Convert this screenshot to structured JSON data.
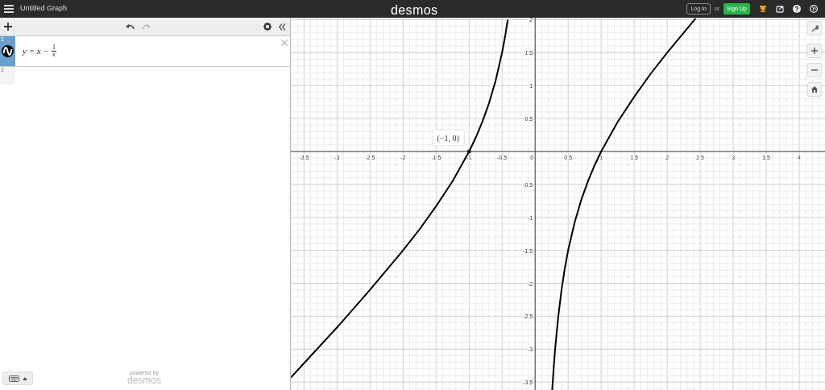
{
  "header": {
    "title": "Untitled Graph",
    "logo": "desmos",
    "login": "Log In",
    "or": "or",
    "signup": "Sign Up"
  },
  "toolbar": {
    "redo_disabled": true
  },
  "expressions": [
    {
      "number": "1",
      "selected": true,
      "expression": {
        "before": "y = x −",
        "numerator": "1",
        "denominator": "x"
      }
    },
    {
      "number": "2",
      "selected": false
    }
  ],
  "footer": {
    "powered": "powered by",
    "brand": "desmos"
  },
  "graph": {
    "chart_data": {
      "type": "line",
      "grid": true,
      "xlim": [
        -3.7,
        4.39
      ],
      "ylim": [
        -3.62,
        2.03
      ],
      "xticks": [
        -3.5,
        -3,
        -2.5,
        -2,
        -1.5,
        -1,
        -0.5,
        0,
        0.5,
        1,
        1.5,
        2,
        2.5,
        3,
        3.5,
        4
      ],
      "yticks": [
        -3.5,
        -3,
        -2.5,
        -2,
        -1.5,
        -1,
        -0.5,
        0.5,
        1,
        1.5,
        2
      ],
      "x": [
        -3.7,
        -3,
        -2.5,
        -2,
        -1.75,
        -1.5,
        -1.25,
        -1,
        -0.9,
        -0.8,
        -0.7,
        -0.6,
        -0.5,
        -0.45,
        -0.415,
        0.258,
        0.28,
        0.3,
        0.32,
        0.35,
        0.4,
        0.45,
        0.5,
        0.6,
        0.7,
        0.8,
        0.9,
        1,
        1.25,
        1.5,
        1.75,
        2,
        2.43
      ],
      "series": [
        {
          "color": "#000000",
          "values": [
            -3.43,
            -2.67,
            -2.1,
            -1.5,
            -1.18,
            -0.83,
            -0.45,
            0,
            0.21,
            0.45,
            0.73,
            1.07,
            1.5,
            1.77,
            2,
            -3.62,
            -3.29,
            -3.03,
            -2.81,
            -2.51,
            -2.1,
            -1.77,
            -1.5,
            -1.07,
            -0.73,
            -0.45,
            -0.21,
            0,
            0.45,
            0.83,
            1.18,
            1.5,
            2.02
          ]
        }
      ],
      "annotations": [
        {
          "x": -1,
          "y": 0,
          "text": "(−1, 0)"
        }
      ]
    }
  }
}
